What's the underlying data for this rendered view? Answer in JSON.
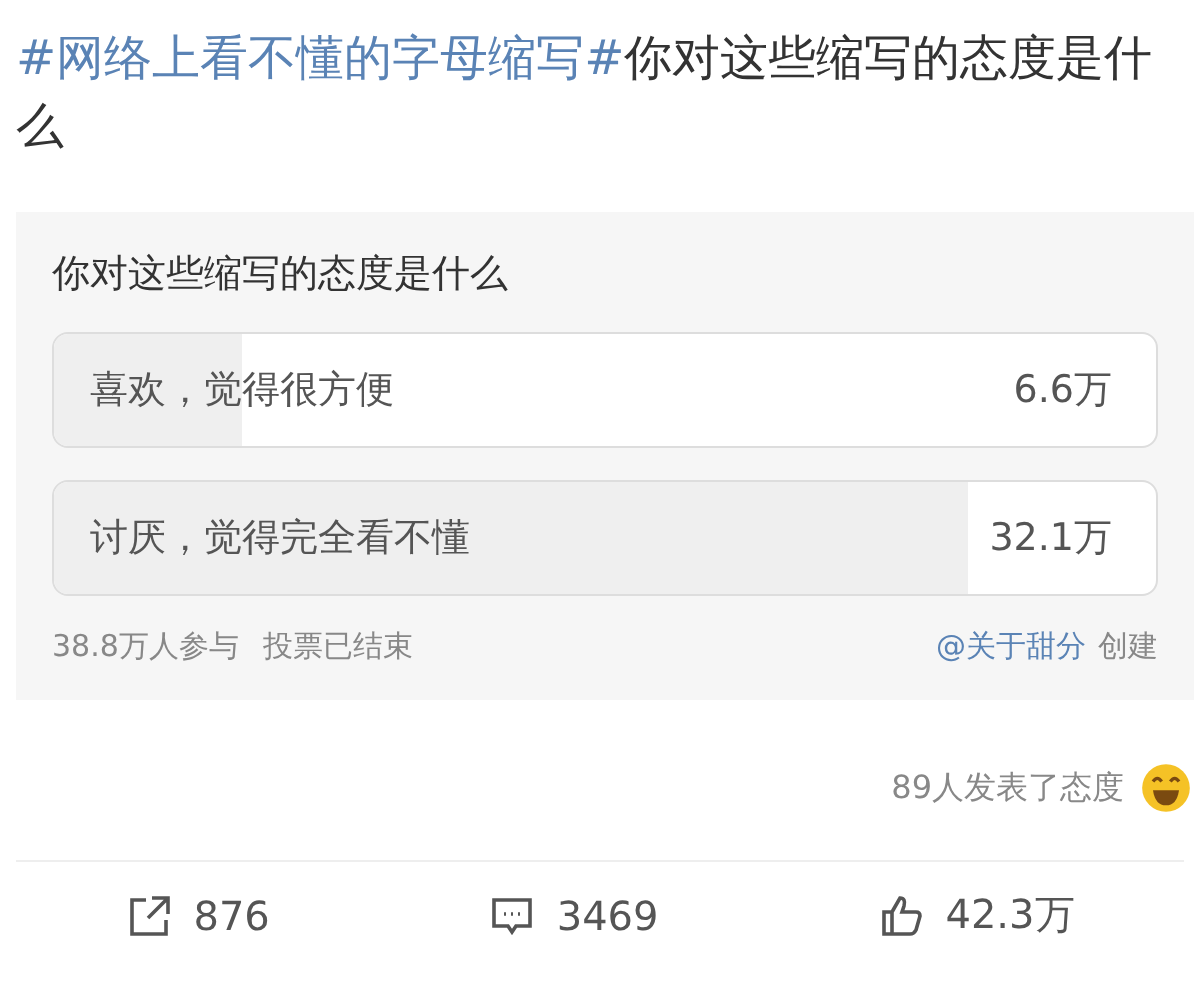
{
  "post": {
    "topic": "#网络上看不懂的字母缩写#",
    "text": "你对这些缩写的态度是什么"
  },
  "poll": {
    "title": "你对这些缩写的态度是什么",
    "options": [
      {
        "label": "喜欢，觉得很方便",
        "count": "6.6万",
        "level": 0.17
      },
      {
        "label": "讨厌，觉得完全看不懂",
        "count": "32.1万",
        "level": 0.83
      }
    ],
    "participants": "38.8万人参与",
    "status": "投票已结束",
    "creator": "@关于甜分",
    "created": "创建"
  },
  "reactions": "89人发表了态度",
  "actions": [
    {
      "kind": "repost",
      "count": "876"
    },
    {
      "kind": "comment",
      "count": "3469"
    },
    {
      "kind": "like",
      "count": "42.3万"
    }
  ]
}
